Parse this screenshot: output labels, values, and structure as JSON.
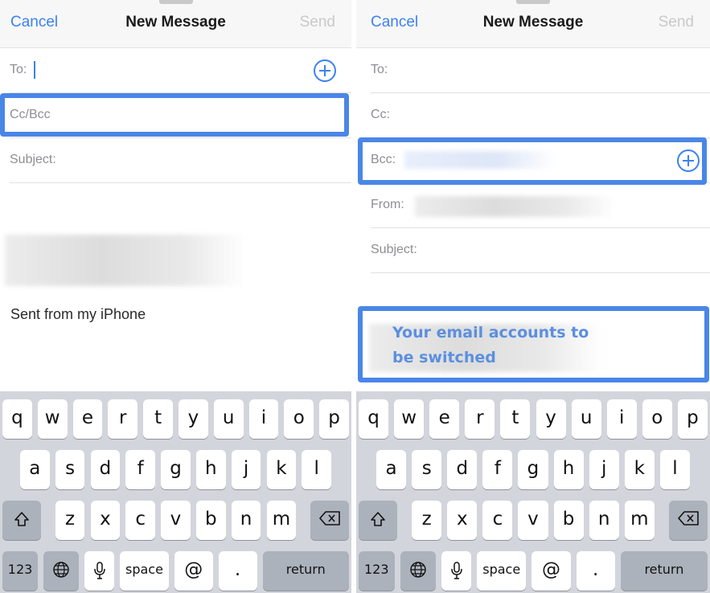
{
  "panels": [
    {
      "nav": {
        "cancel": "Cancel",
        "title": "New Message",
        "send": "Send"
      },
      "fields": {
        "to": "To:",
        "cc_bcc": "Cc/Bcc",
        "subject": "Subject:"
      },
      "body": {
        "signature": "Sent from my iPhone"
      },
      "highlight": "cc-bcc-field"
    },
    {
      "nav": {
        "cancel": "Cancel",
        "title": "New Message",
        "send": "Send"
      },
      "fields": {
        "to": "To:",
        "cc": "Cc:",
        "bcc": "Bcc:",
        "from": "From:",
        "subject": "Subject:"
      },
      "annotation": {
        "line1": "Your email accounts to",
        "line2": "be switched"
      },
      "highlight": "bcc-field"
    }
  ],
  "keyboard": {
    "row1": [
      "q",
      "w",
      "e",
      "r",
      "t",
      "y",
      "u",
      "i",
      "o",
      "p"
    ],
    "row2": [
      "a",
      "s",
      "d",
      "f",
      "g",
      "h",
      "j",
      "k",
      "l"
    ],
    "row3": [
      "z",
      "x",
      "c",
      "v",
      "b",
      "n",
      "m"
    ],
    "numbers": "123",
    "space": "space",
    "at": "@",
    "dot": ".",
    "return": "return"
  },
  "colors": {
    "accent": "#3c82f0",
    "highlight": "#4a86e8",
    "keyboard_bg": "#d2d5db"
  }
}
